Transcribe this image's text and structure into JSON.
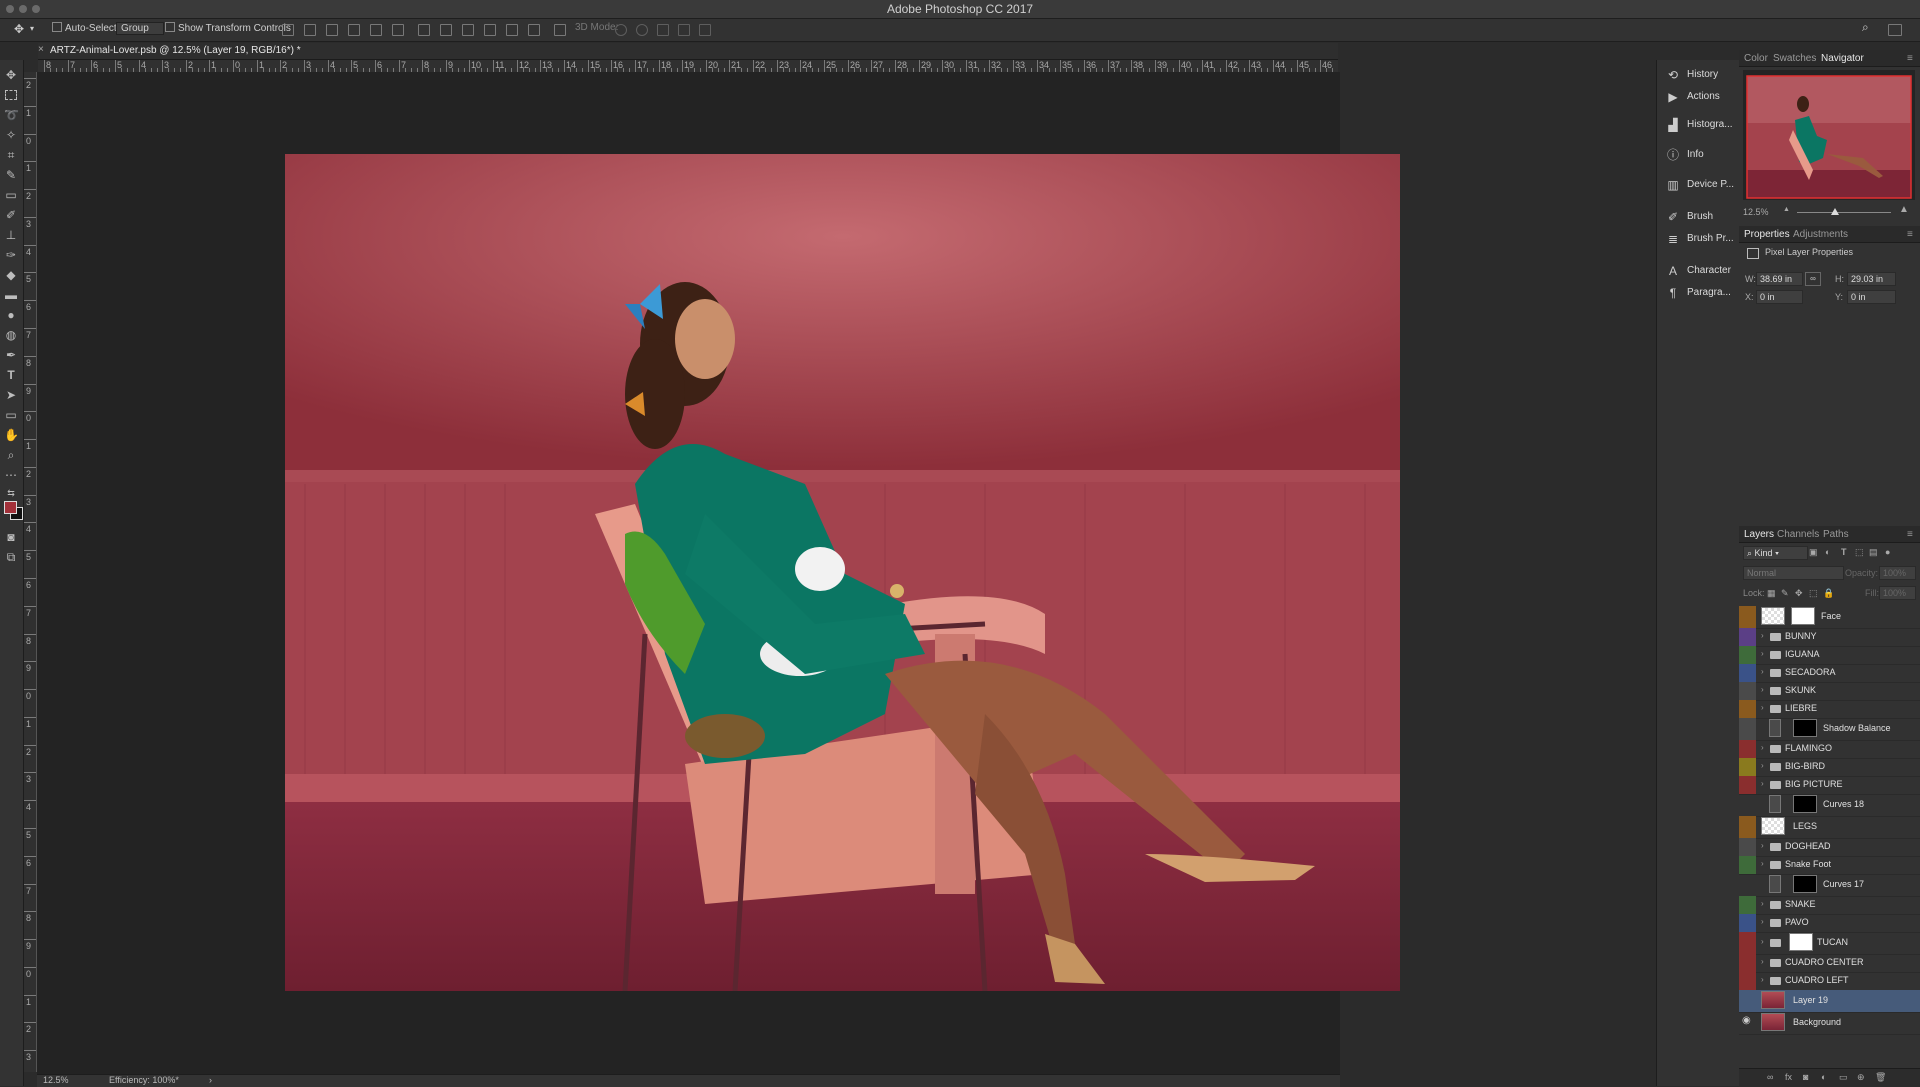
{
  "app": {
    "title": "Adobe Photoshop CC 2017"
  },
  "options_bar": {
    "auto_select_label": "Auto-Select:",
    "auto_select_value": "Group",
    "transform_label": "Show Transform Controls",
    "mode_3d_label": "3D Mode:"
  },
  "document": {
    "tab_title": "ARTZ-Animal-Lover.psb @ 12.5% (Layer 19, RGB/16*) *"
  },
  "rulers": {
    "h_labels": [
      "8",
      "7",
      "6",
      "5",
      "4",
      "3",
      "2",
      "1",
      "0",
      "1",
      "2",
      "3",
      "4",
      "5",
      "6",
      "7",
      "8",
      "9",
      "10",
      "11",
      "12",
      "13",
      "14",
      "15",
      "16",
      "17",
      "18",
      "19",
      "20",
      "21",
      "22",
      "23",
      "24",
      "25",
      "26",
      "27",
      "28",
      "29",
      "30",
      "31",
      "32",
      "33",
      "34",
      "35",
      "36",
      "37",
      "38",
      "39",
      "40",
      "41",
      "42",
      "43",
      "44",
      "45",
      "46"
    ],
    "v_labels": [
      "2",
      "1",
      "0",
      "1",
      "2",
      "3",
      "4",
      "5",
      "6",
      "7",
      "8",
      "9",
      "0",
      "1",
      "2",
      "3",
      "4",
      "5",
      "6",
      "7",
      "8",
      "9",
      "0",
      "1",
      "2",
      "3",
      "4",
      "5",
      "6",
      "7",
      "8",
      "9",
      "0",
      "1",
      "2",
      "3"
    ]
  },
  "status": {
    "zoom": "12.5%",
    "efficiency": "Efficiency: 100%*"
  },
  "collapsed_panels": [
    {
      "label": "History",
      "icon": "history-icon"
    },
    {
      "label": "Actions",
      "icon": "play-icon"
    },
    {
      "label": "Histogra...",
      "icon": "histogram-icon"
    },
    {
      "label": "Info",
      "icon": "info-icon"
    },
    {
      "label": "Device P...",
      "icon": "device-preview-icon"
    },
    {
      "label": "Brush",
      "icon": "brush-icon"
    },
    {
      "label": "Brush Pr...",
      "icon": "brush-presets-icon"
    },
    {
      "label": "Character",
      "icon": "character-icon"
    },
    {
      "label": "Paragra...",
      "icon": "paragraph-icon"
    }
  ],
  "navigator_panel": {
    "tabs": [
      "Color",
      "Swatches",
      "Navigator"
    ],
    "active_tab": "Navigator",
    "zoom": "12.5%"
  },
  "properties_panel": {
    "tabs": [
      "Properties",
      "Adjustments"
    ],
    "header": "Pixel Layer Properties",
    "w_label": "W:",
    "w_value": "38.69 in",
    "h_label": "H:",
    "h_value": "29.03 in",
    "x_label": "X:",
    "x_value": "0 in",
    "y_label": "Y:",
    "y_value": "0 in"
  },
  "layers_panel": {
    "tabs": [
      "Layers",
      "Channels",
      "Paths"
    ],
    "filter_kind": "Kind",
    "blend_mode": "Normal",
    "opacity_label": "Opacity:",
    "opacity_value": "100%",
    "lock_label": "Lock:",
    "fill_label": "Fill:",
    "fill_value": "100%",
    "layers": [
      {
        "name": "Face",
        "kind": "mask",
        "color": "#8a5a1e"
      },
      {
        "name": "BUNNY",
        "kind": "group",
        "color": "#5b3f86"
      },
      {
        "name": "IGUANA",
        "kind": "group",
        "color": "#3e6b3a"
      },
      {
        "name": "SECADORA",
        "kind": "group",
        "color": "#3a5288"
      },
      {
        "name": "SKUNK",
        "kind": "group",
        "color": "#4a4a4a"
      },
      {
        "name": "LIEBRE",
        "kind": "group",
        "color": "#8a5a1e"
      },
      {
        "name": "Shadow Balance",
        "kind": "adjust",
        "color": "#4a4a4a"
      },
      {
        "name": "FLAMINGO",
        "kind": "group",
        "color": "#8a2e2e"
      },
      {
        "name": "BIG-BIRD",
        "kind": "group",
        "color": "#8a7a1e"
      },
      {
        "name": "BIG PICTURE",
        "kind": "group",
        "color": "#8a2e2e"
      },
      {
        "name": "Curves 18",
        "kind": "adjust",
        "color": ""
      },
      {
        "name": "LEGS",
        "kind": "pixel",
        "color": "#8a5a1e"
      },
      {
        "name": "DOGHEAD",
        "kind": "group",
        "color": "#4a4a4a"
      },
      {
        "name": "Snake Foot",
        "kind": "group",
        "color": "#3e6b3a"
      },
      {
        "name": "Curves 17",
        "kind": "adjust",
        "color": ""
      },
      {
        "name": "SNAKE",
        "kind": "group",
        "color": "#3e6b3a"
      },
      {
        "name": "PAVO",
        "kind": "group",
        "color": "#3a5288"
      },
      {
        "name": "TUCAN",
        "kind": "groupmask",
        "color": "#8a2e2e"
      },
      {
        "name": "CUADRO CENTER",
        "kind": "group",
        "color": "#8a2e2e"
      },
      {
        "name": "CUADRO LEFT",
        "kind": "group",
        "color": "#8a2e2e"
      },
      {
        "name": "Layer 19",
        "kind": "photo",
        "color": "",
        "selected": true
      },
      {
        "name": "Background",
        "kind": "photo",
        "color": "",
        "visible": true
      }
    ]
  }
}
